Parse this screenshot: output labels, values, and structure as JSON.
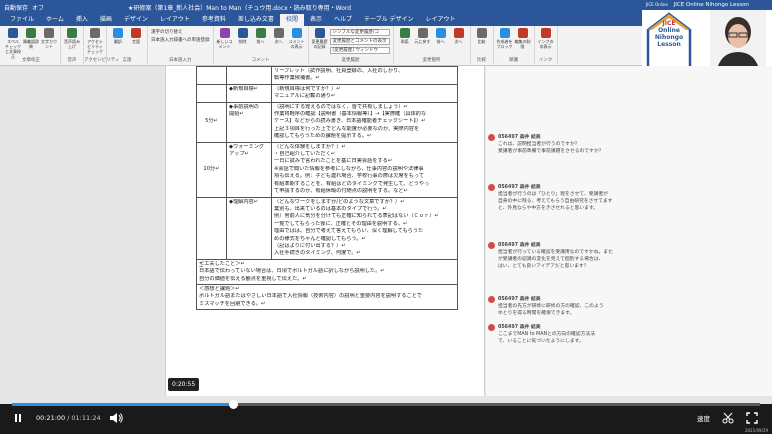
{
  "titlebar": {
    "autosave": "自動保存",
    "autosave_state": "オフ",
    "doc_title": "★研修案（第1章_新人社会）Man to Man（チュウ用.docx・読み取り専用・Word"
  },
  "menu": {
    "tabs": [
      "ファイル",
      "ホーム",
      "挿入",
      "描画",
      "デザイン",
      "レイアウト",
      "参考資料",
      "差し込み文書",
      "校閲",
      "表示",
      "ヘルプ",
      "テーブル デザイン",
      "レイアウト"
    ],
    "active_index": 8
  },
  "ribbon": {
    "groups": [
      {
        "label": "文章校正",
        "buttons": [
          "スペル チェックと文章校正",
          "類義語辞典",
          "文字カウント"
        ]
      },
      {
        "label": "音声",
        "buttons": [
          "音声読み上げ"
        ]
      },
      {
        "label": "アクセシビリティ",
        "buttons": [
          "アクセシビリティ チェック"
        ]
      },
      {
        "label": "言語",
        "buttons": [
          "翻訳",
          "言語"
        ]
      },
      {
        "label": "日本語入力",
        "small": [
          "漢字の切り替え",
          "日本語入力辞書への単語登録"
        ]
      },
      {
        "label": "コメント",
        "buttons": [
          "新しいコメント",
          "削除",
          "前へ",
          "次へ",
          "コメントの表示"
        ]
      },
      {
        "label": "変更履歴",
        "buttons": [
          "変更履歴の記録"
        ],
        "small": [
          "シンプルな変更履歴/コ",
          "変更履歴とコメントの表示",
          "[変更履歴] ウィンドウ"
        ]
      },
      {
        "label": "変更箇所",
        "buttons": [
          "承諾",
          "元に戻す",
          "前へ",
          "次へ"
        ]
      },
      {
        "label": "比較",
        "buttons": [
          "比較"
        ]
      },
      {
        "label": "保護",
        "buttons": [
          "作成者をブロック",
          "編集の制限"
        ]
      },
      {
        "label": "インク",
        "buttons": [
          "インクの非表示"
        ]
      }
    ]
  },
  "video_panel": {
    "title": "JICE Online Nihongo Lesson",
    "brand_small": "JICE Online",
    "logo_lines": [
      "JICE",
      "Online",
      "Nihongo",
      "Lesson"
    ]
  },
  "table": {
    "rows": [
      {
        "time": "",
        "item": [],
        "content": [
          "リーフレット（試作説明、社員登録の、入社のしかり、",
          "転等作業候補書。↵"
        ]
      },
      {
        "time": "",
        "item": [
          "◆新規目標↵"
        ],
        "content": [
          "（新規目標は何ですか？）↵",
          "マニュアルに記載の通り↵"
        ]
      },
      {
        "time": "5分↵",
        "item": [
          "◆事前説明の",
          "開始↵"
        ],
        "content": [
          "（説明にする覚えるのではなく、皆で共有しましょう）↵",
          "作業将軽序の確認【説明書（基本情報等）】→【実際確（具体的な",
          "ケース】などからの読み書き、日本語確能者チェックシート】）↵",
          "上記３項目を行った上でどんな能度が必要なのか、実際内容を",
          "確認してもらうための課題を提示する。↵"
        ]
      },
      {
        "time": "10分↵",
        "item": [
          "◆ウォーミング",
          "アップ↵"
        ],
        "content": [
          "（どんな体験をしますか？）↵",
          "・自己紹介していただく↵",
          "一日に試みで言われたことを基に日実会話をする↵",
          "※会話で聞いた情報を参考にしながら、仕事内容の説明や法律事",
          "項も伝える。例：子ども連れ場合、学校行事の際は欠席をもって",
          "有給準期することを、有給はどのタイミングで発生して、どうやっ",
          "て申請するのか、有給休暇の付随点の説明をする。など↵"
        ]
      },
      {
        "time": "",
        "item": [
          "◆理解内容↵"
        ],
        "content": [
          "（どんなワークをしますか/どのような文章ですか？）↵",
          "業別も、出来ているのは基本のタイプで行う。↵",
          "例）男前人に気分を分けても正確に知られてる表記はない（Ｃｏｒ）↵",
          "一覧でしてもらった後に、正確とその理由を説明する。↵",
          "理由ではは、自分で考えて答えてもらい、深く理解してもらうた",
          "めの様式をちゃんと確認してもらう。↵",
          "（記はよりに付い出する？）↵",
          "入社手続きのタイミング、何度で。↵"
        ]
      },
      {
        "time": "",
        "item": [],
        "content": [
          "＜工夫したこと＞↵",
          "日本語で伝わっていない場合は、日頃でポルトガル語に訳しながら説明した。↵",
          "自分の価値を伝える観点を重視して伝えた。↵"
        ],
        "span": true
      },
      {
        "time": "",
        "item": [],
        "content": [
          "＜感想と課題＞↵",
          "ポルトガル語またはやさしい日本語で入社情報（技術内容）の説明と重要内容を説明することで",
          "ミスマッチを回避できる。↵"
        ],
        "span": true
      }
    ]
  },
  "comments": [
    {
      "author": "056497 森井 結美",
      "lines": [
        "これは、説明担当者が行うのですか？",
        "受講者が事前準備で事前課題をさせるのですか？"
      ]
    },
    {
      "author": "056497 森井 結美",
      "lines": [
        "担当者が行うのは「ひとり」程をさせて、受講者が",
        "自身の中に残る、考えてもらう自由研究をさせてます",
        "と、外見ならや中方をきさせれると思います。"
      ]
    },
    {
      "author": "056497 森井 結美",
      "lines": [
        "担当者が行っている確認を受講用なのですかね。また",
        "が受講者の認識の変化を見えて個別する場合は、",
        "はい、とても良いアイデアだと思います？"
      ]
    },
    {
      "author": "056497 森井 結美",
      "lines": [
        "担当者の先方が研修に研修の方の確認、このよう",
        "ゆとりを得る時間を確保できます。"
      ]
    },
    {
      "author": "056497 森井 結美",
      "lines": [
        "ここまでMAN to MANとの方向の確認方法法",
        "で、いることに気づいたようにします。"
      ]
    }
  ],
  "player": {
    "tooltip_time": "0:20:55",
    "current_time": "00:21:00",
    "separator": "/",
    "total_time": "01:11:24",
    "progress": 0.296,
    "speed_label": "速度",
    "date": "2021/09/29"
  },
  "colors": {
    "word_blue": "#2b579a",
    "progress_blue": "#2b8de3",
    "comment_avatar": "#d24b4b"
  }
}
